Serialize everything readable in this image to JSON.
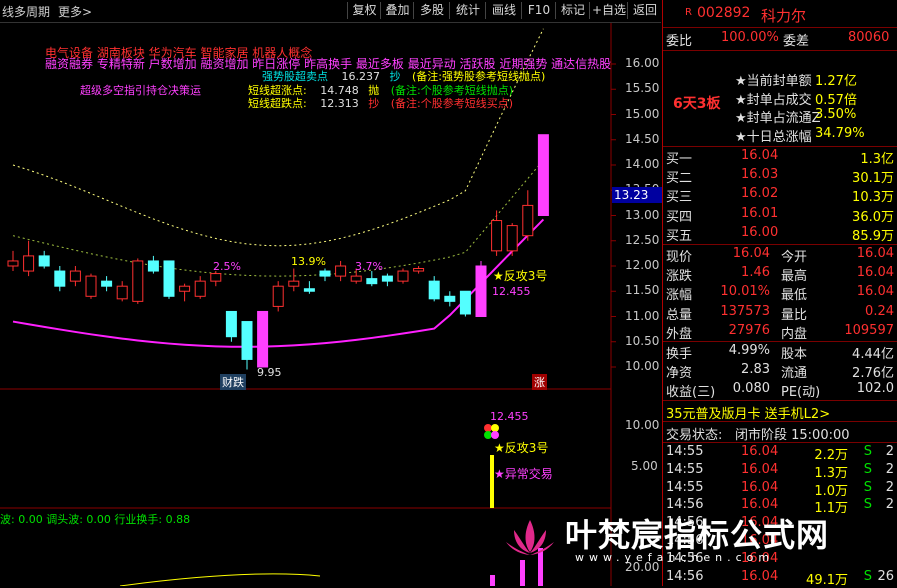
{
  "toolbar": {
    "left": [
      "线",
      "多周期",
      "更多>"
    ],
    "buttons": [
      "复权",
      "叠加",
      "多股",
      "统计",
      "画线",
      "F10",
      "标记",
      "+自选",
      "返回"
    ]
  },
  "concept_tags": {
    "line1": "电气设备  湖南板块  华为汽车 智能家居 机器人概念",
    "line2": "融资融券 专精特新 户数增加 融资增加 昨日涨停 昨高换手 最近多板 最近异动 活跃股 近期强势 通达信热股"
  },
  "indicator_text": {
    "main_title": "超级多空指引持仓决策运",
    "r1": {
      "label": "强势股超卖点",
      "value": "16.237",
      "action": "抄",
      "note": "(备注:强势股参考短线抛点)"
    },
    "r2": {
      "label": "短线超涨点:",
      "value": "14.748",
      "action": "抛",
      "note": "(备注:个股参考短线抛点)"
    },
    "r3": {
      "label": "短线超跌点:",
      "value": "12.313",
      "action": "抄",
      "note": "(备注:个股参考短线买点)"
    }
  },
  "chart_annotations": {
    "pct1": "2.5%",
    "pct2": "13.9%",
    "pct3": "3.7%",
    "low_price": "9.95",
    "signal": "★反攻3号",
    "signal_price": "12.455",
    "badge_left": "财跌",
    "badge_right": "涨",
    "lower_signal": "★反攻3号",
    "lower_signal2": "★异常交易",
    "lower_price": "12.455",
    "bottom_line": "波: 0.00  调头波: 0.00  行业换手: 0.88"
  },
  "axis": {
    "upper": [
      "16.00",
      "15.50",
      "15.00",
      "14.50",
      "14.00",
      "13.50",
      "13.00",
      "12.50",
      "12.00",
      "11.50",
      "11.00",
      "10.50",
      "10.00"
    ],
    "current_price_tag": "13.23",
    "lower": [
      "10.00",
      "5.00"
    ],
    "bottom": "20.00"
  },
  "panel": {
    "code": "002892",
    "name": "科力尔",
    "r_mark": "R",
    "weibi_label": "委比",
    "weibi": "100.00%",
    "weicha_label": "委差",
    "weicha": "80060",
    "streak": "6天3板",
    "stats": [
      {
        "label": "当前封单额",
        "value": "1.27亿"
      },
      {
        "label": "封单占成交",
        "value": "0.57倍"
      },
      {
        "label": "封单占流通Z",
        "value": "3.50%"
      },
      {
        "label": "十日总涨幅",
        "value": "34.79%"
      }
    ],
    "bids": [
      {
        "label": "买一",
        "price": "16.04",
        "vol": "1.3亿"
      },
      {
        "label": "买二",
        "price": "16.03",
        "vol": "30.1万"
      },
      {
        "label": "买三",
        "price": "16.02",
        "vol": "10.3万"
      },
      {
        "label": "买四",
        "price": "16.01",
        "vol": "36.0万"
      },
      {
        "label": "买五",
        "price": "16.00",
        "vol": "85.9万"
      }
    ],
    "quote": [
      {
        "l1": "现价",
        "v1": "16.04",
        "l2": "今开",
        "v2": "16.04"
      },
      {
        "l1": "涨跌",
        "v1": "1.46",
        "l2": "最高",
        "v2": "16.04"
      },
      {
        "l1": "涨幅",
        "v1": "10.01%",
        "l2": "最低",
        "v2": "16.04"
      },
      {
        "l1": "总量",
        "v1": "137573",
        "l2": "量比",
        "v2": "0.24"
      },
      {
        "l1": "外盘",
        "v1": "27976",
        "l2": "内盘",
        "v2": "109597"
      }
    ],
    "fund": [
      {
        "l1": "换手",
        "v1": "4.99%",
        "l2": "股本",
        "v2": "4.44亿"
      },
      {
        "l1": "净资",
        "v1": "2.83",
        "l2": "流通",
        "v2": "2.76亿"
      },
      {
        "l1": "收益(三)",
        "v1": "0.080",
        "l2": "PE(动)",
        "v2": "102.0"
      }
    ],
    "promo": "35元普及版月卡 送手机L2>",
    "status_label": "交易状态:",
    "status_value": "闭市阶段 15:00:00",
    "ticks": [
      {
        "time": "14:55",
        "price": "16.04",
        "vol": "2.2万",
        "side": "S",
        "n": "2"
      },
      {
        "time": "14:55",
        "price": "16.04",
        "vol": "1.3万",
        "side": "S",
        "n": "2"
      },
      {
        "time": "14:55",
        "price": "16.04",
        "vol": "1.0万",
        "side": "S",
        "n": "2"
      },
      {
        "time": "14:56",
        "price": "16.04",
        "vol": "1.1万",
        "side": "S",
        "n": "2"
      },
      {
        "time": "14:56",
        "price": "16.04",
        "vol": "",
        "side": "",
        "n": ""
      },
      {
        "time": "14:56",
        "price": "16.04",
        "vol": "",
        "side": "",
        "n": ""
      },
      {
        "time": "14:56",
        "price": "16.04",
        "vol": "",
        "side": "",
        "n": ""
      },
      {
        "time": "14:56",
        "price": "16.04",
        "vol": "49.1万",
        "side": "S",
        "n": "26"
      }
    ]
  },
  "watermark": {
    "main": "叶梵宸指标公式网",
    "url": "www.yefanchen.com"
  },
  "candles": [
    {
      "o": 12.1,
      "c": 12.0,
      "h": 12.3,
      "l": 11.9,
      "col": "red"
    },
    {
      "o": 12.2,
      "c": 11.9,
      "h": 12.5,
      "l": 11.8,
      "col": "red"
    },
    {
      "o": 12.0,
      "c": 12.2,
      "h": 12.3,
      "l": 11.95,
      "col": "cyan"
    },
    {
      "o": 11.9,
      "c": 11.6,
      "h": 12.0,
      "l": 11.5,
      "col": "cyan"
    },
    {
      "o": 11.7,
      "c": 11.9,
      "h": 12.0,
      "l": 11.6,
      "col": "red"
    },
    {
      "o": 11.8,
      "c": 11.4,
      "h": 11.85,
      "l": 11.35,
      "col": "red"
    },
    {
      "o": 11.6,
      "c": 11.7,
      "h": 11.8,
      "l": 11.5,
      "col": "cyan"
    },
    {
      "o": 11.6,
      "c": 11.35,
      "h": 11.7,
      "l": 11.3,
      "col": "red"
    },
    {
      "o": 11.3,
      "c": 12.1,
      "h": 12.15,
      "l": 11.25,
      "col": "red"
    },
    {
      "o": 12.1,
      "c": 11.9,
      "h": 12.2,
      "l": 11.85,
      "col": "cyan"
    },
    {
      "o": 12.1,
      "c": 11.4,
      "h": 12.1,
      "l": 11.35,
      "col": "cyan"
    },
    {
      "o": 11.5,
      "c": 11.6,
      "h": 11.65,
      "l": 11.3,
      "col": "red"
    },
    {
      "o": 11.4,
      "c": 11.7,
      "h": 11.8,
      "l": 11.35,
      "col": "red"
    },
    {
      "o": 11.7,
      "c": 11.85,
      "h": 11.9,
      "l": 11.6,
      "col": "red"
    },
    {
      "o": 11.1,
      "c": 10.6,
      "h": 11.1,
      "l": 10.5,
      "col": "cyan"
    },
    {
      "o": 10.9,
      "c": 10.15,
      "h": 10.9,
      "l": 9.95,
      "col": "cyan"
    },
    {
      "o": 10.0,
      "c": 11.1,
      "h": 11.1,
      "l": 10.0,
      "col": "mag"
    },
    {
      "o": 11.2,
      "c": 11.6,
      "h": 11.7,
      "l": 11.1,
      "col": "red"
    },
    {
      "o": 11.6,
      "c": 11.7,
      "h": 11.95,
      "l": 11.5,
      "col": "red"
    },
    {
      "o": 11.5,
      "c": 11.55,
      "h": 11.7,
      "l": 11.45,
      "col": "cyan"
    },
    {
      "o": 11.8,
      "c": 11.9,
      "h": 11.95,
      "l": 11.7,
      "col": "cyan"
    },
    {
      "o": 11.8,
      "c": 12.0,
      "h": 12.1,
      "l": 11.7,
      "col": "red"
    },
    {
      "o": 11.7,
      "c": 11.8,
      "h": 11.95,
      "l": 11.65,
      "col": "red"
    },
    {
      "o": 11.75,
      "c": 11.65,
      "h": 11.9,
      "l": 11.6,
      "col": "cyan"
    },
    {
      "o": 11.7,
      "c": 11.8,
      "h": 11.85,
      "l": 11.6,
      "col": "cyan"
    },
    {
      "o": 11.7,
      "c": 11.9,
      "h": 11.95,
      "l": 11.65,
      "col": "red"
    },
    {
      "o": 11.9,
      "c": 11.95,
      "h": 12.0,
      "l": 11.85,
      "col": "red"
    },
    {
      "o": 11.7,
      "c": 11.35,
      "h": 11.8,
      "l": 11.3,
      "col": "cyan"
    },
    {
      "o": 11.4,
      "c": 11.3,
      "h": 11.5,
      "l": 11.2,
      "col": "cyan"
    },
    {
      "o": 11.5,
      "c": 11.05,
      "h": 11.5,
      "l": 11.0,
      "col": "cyan"
    },
    {
      "o": 11.0,
      "c": 12.0,
      "h": 12.1,
      "l": 11.0,
      "col": "mag"
    },
    {
      "o": 12.3,
      "c": 12.9,
      "h": 13.1,
      "l": 12.2,
      "col": "red"
    },
    {
      "o": 12.3,
      "c": 12.8,
      "h": 12.85,
      "l": 12.2,
      "col": "red"
    },
    {
      "o": 12.6,
      "c": 13.2,
      "h": 13.5,
      "l": 12.5,
      "col": "red"
    },
    {
      "o": 13.0,
      "c": 14.6,
      "h": 14.6,
      "l": 13.0,
      "col": "mag"
    }
  ]
}
